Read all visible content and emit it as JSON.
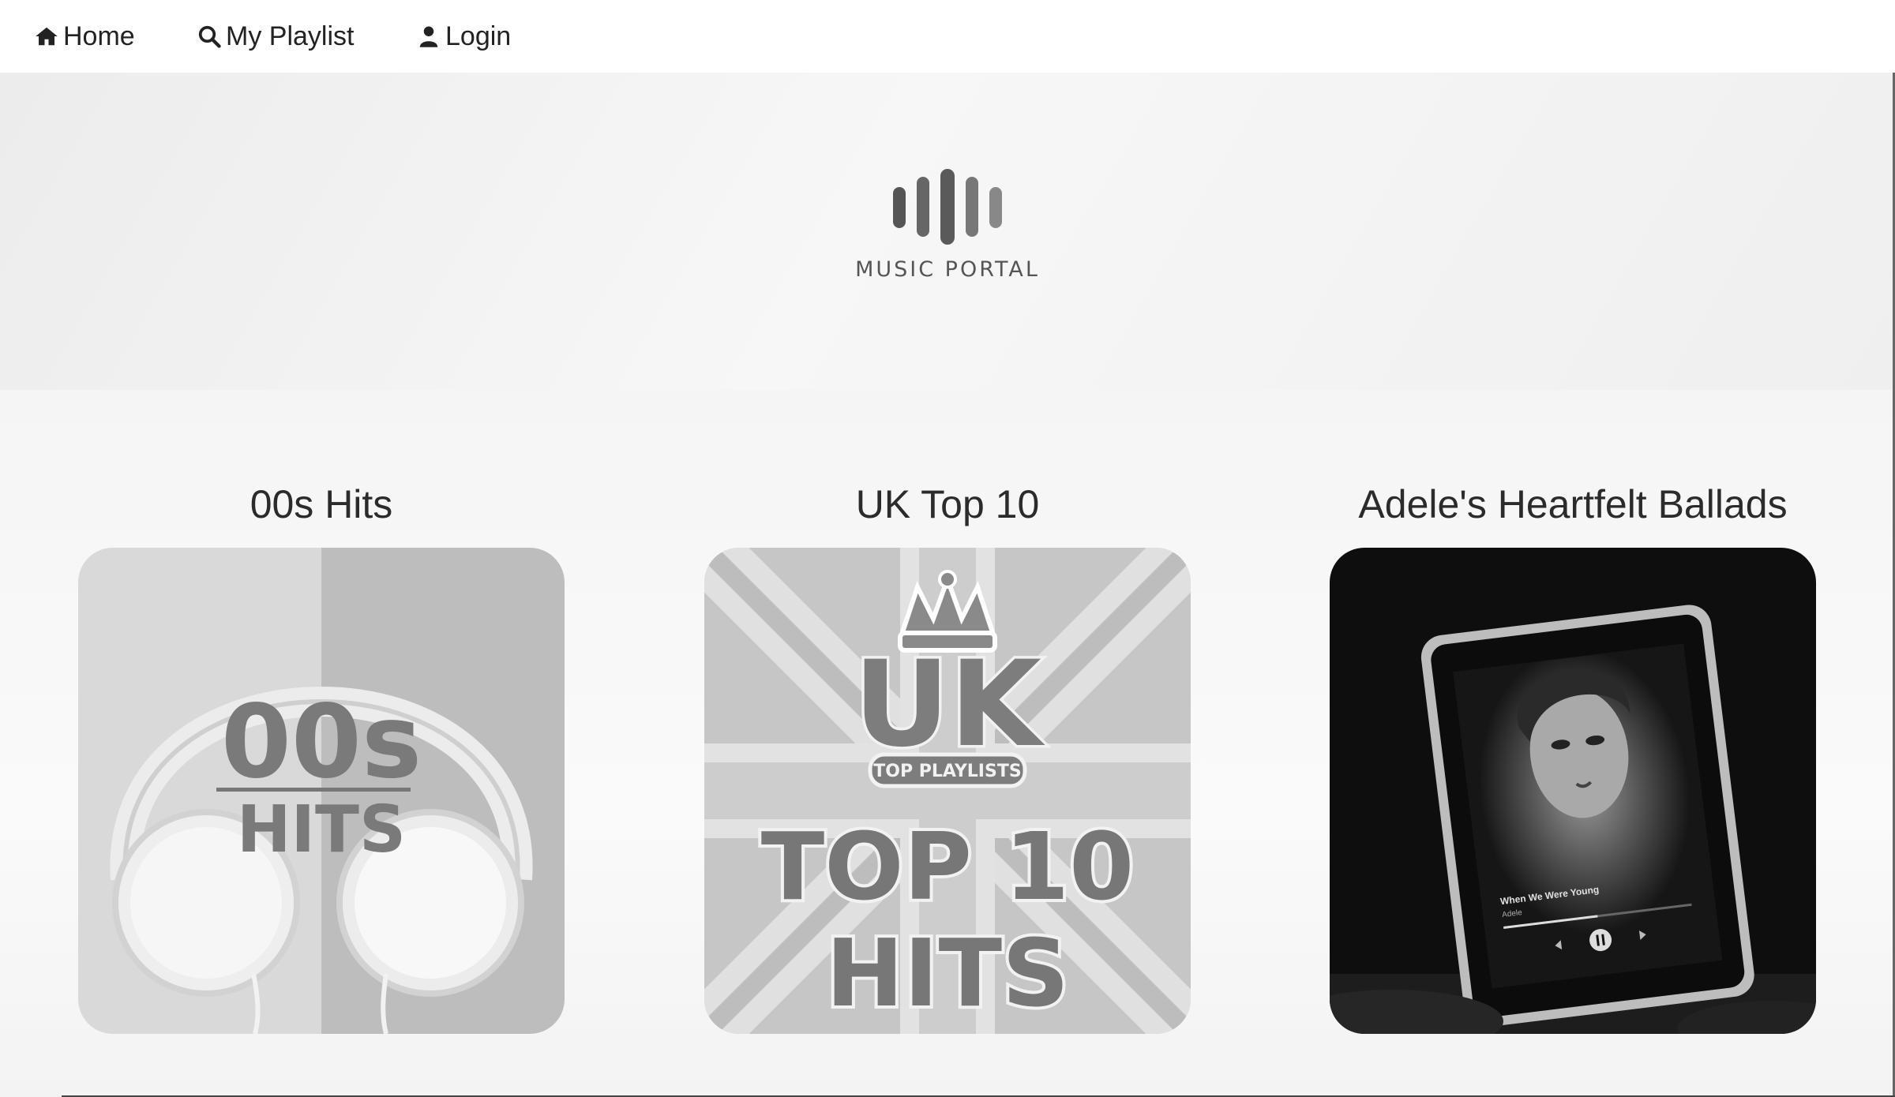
{
  "nav": {
    "home": {
      "label": "Home",
      "icon": "home-icon"
    },
    "playlist": {
      "label": "My Playlist",
      "icon": "search-icon"
    },
    "login": {
      "label": "Login",
      "icon": "user-icon"
    }
  },
  "hero": {
    "logo_text": "MUSIC PORTAL"
  },
  "playlists": [
    {
      "title": "00s Hits",
      "art_text": [
        "00s",
        "HITS"
      ]
    },
    {
      "title": "UK Top 10",
      "art_text": [
        "UK",
        "TOP PLAYLISTS",
        "TOP 10",
        "HITS"
      ]
    },
    {
      "title": "Adele's Heartfelt Ballads",
      "art_text": [
        "When We Were Young",
        "Adele"
      ]
    }
  ]
}
